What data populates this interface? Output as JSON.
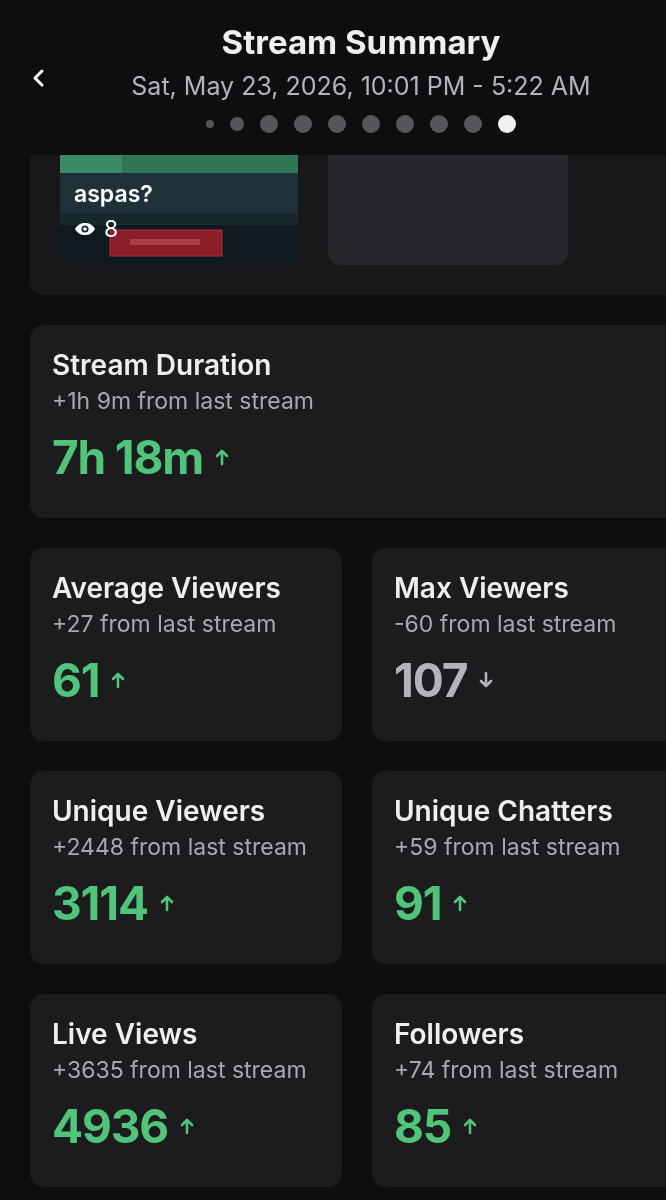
{
  "header": {
    "title": "Stream Summary",
    "subtitle": "Sat, May 23, 2026, 10:01 PM - 5:22 AM",
    "pages": [
      {
        "selected": false
      },
      {
        "selected": false
      },
      {
        "selected": false
      },
      {
        "selected": false
      },
      {
        "selected": false
      },
      {
        "selected": false
      },
      {
        "selected": false
      },
      {
        "selected": false
      },
      {
        "selected": false
      },
      {
        "selected": true
      }
    ]
  },
  "clips": [
    {
      "kind": "clip",
      "title": "aspas?",
      "views": "8"
    },
    {
      "kind": "placeholder"
    }
  ],
  "duration": {
    "title": "Stream Duration",
    "change": "+1h 9m from last stream",
    "value": "7h 18m",
    "increased": true
  },
  "stats": [
    {
      "title": "Average Viewers",
      "change": "+27 from last stream",
      "value": "61",
      "increased": true
    },
    {
      "title": "Max Viewers",
      "change": "-60 from last stream",
      "value": "107",
      "increased": false
    },
    {
      "title": "Unique Viewers",
      "change": "+2448 from last stream",
      "value": "3114",
      "increased": true
    },
    {
      "title": "Unique Chatters",
      "change": "+59 from last stream",
      "value": "91",
      "increased": true
    },
    {
      "title": "Live Views",
      "change": "+3635 from last stream",
      "value": "4936",
      "increased": true
    },
    {
      "title": "Followers",
      "change": "+74 from last stream",
      "value": "85",
      "increased": true
    }
  ]
}
